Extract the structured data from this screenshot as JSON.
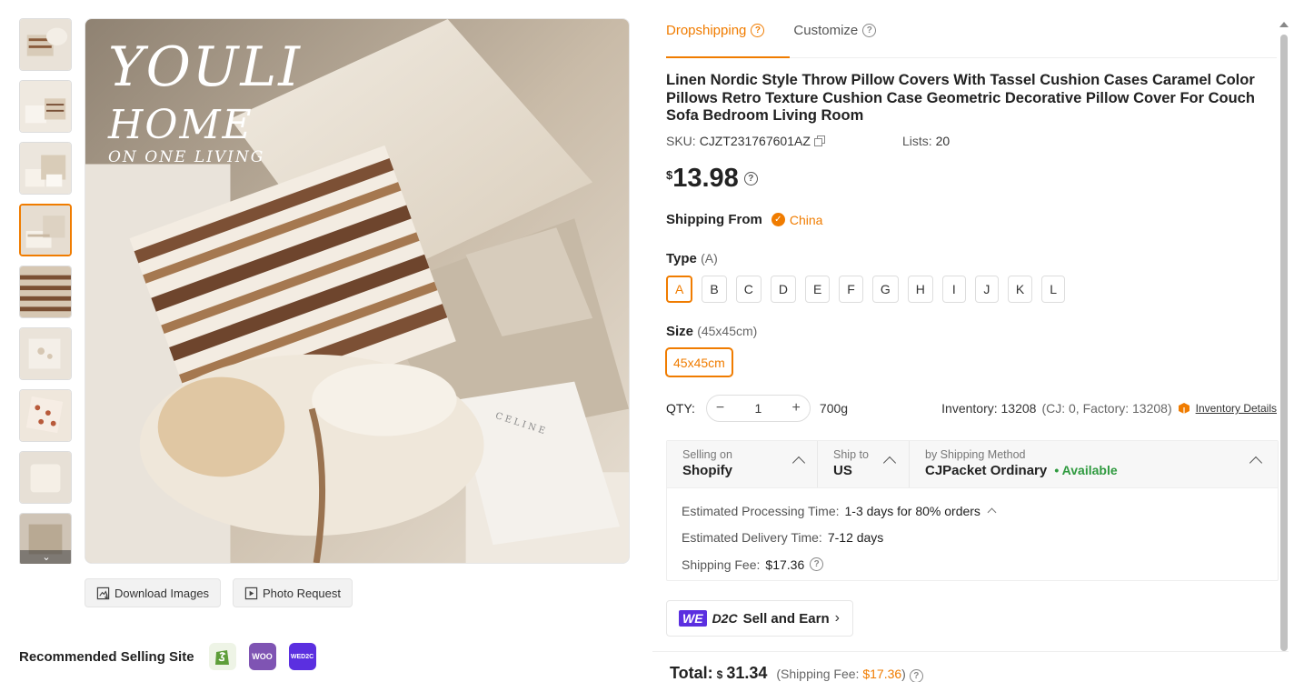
{
  "gallery": {
    "thumb_count": 9,
    "active_index": 3,
    "more_icon": "chevron-down-icon",
    "main_image_alt": "Linen pillow covers arranged on a sofa",
    "brand_line1": "YOULI",
    "brand_line2": "HOME",
    "brand_line3": "ON ONE LIVING",
    "magazine_text": "CELINE"
  },
  "image_actions": {
    "download_label": "Download Images",
    "photo_request_label": "Photo Request"
  },
  "recommended": {
    "label": "Recommended Selling Site",
    "sites": [
      "shopify",
      "woo",
      "wed2c"
    ],
    "woo_text": "WOO",
    "wed2c_text": "WED2C"
  },
  "tabs": [
    {
      "label": "Dropshipping",
      "active": true
    },
    {
      "label": "Customize",
      "active": false
    }
  ],
  "product": {
    "title": "Linen Nordic Style Throw Pillow Covers With Tassel Cushion Cases Caramel Color Pillows Retro Texture Cushion Case Geometric Decorative Pillow Cover For Couch Sofa Bedroom Living Room",
    "sku_label": "SKU:",
    "sku": "CJZT231767601AZ",
    "lists_label": "Lists:",
    "lists": "20",
    "currency": "$",
    "price": "13.98"
  },
  "shipping_from": {
    "label": "Shipping From",
    "value": "China"
  },
  "type": {
    "label": "Type",
    "selected": "(A)",
    "options": [
      "A",
      "B",
      "C",
      "D",
      "E",
      "F",
      "G",
      "H",
      "I",
      "J",
      "K",
      "L"
    ]
  },
  "size": {
    "label": "Size",
    "selected": "(45x45cm)",
    "option": "45x45cm"
  },
  "qty": {
    "label": "QTY:",
    "minus": "−",
    "value": "1",
    "plus": "+",
    "weight": "700g",
    "inventory": "Inventory: 13208",
    "inventory_detail": "(CJ: 0, Factory: 13208)",
    "inventory_link": "Inventory Details"
  },
  "shipping": {
    "selling_on_label": "Selling on",
    "selling_on": "Shopify",
    "ship_to_label": "Ship to",
    "ship_to": "US",
    "method_label": "by Shipping Method",
    "method": "CJPacket Ordinary",
    "availability": "• Available",
    "processing_label": "Estimated Processing Time:",
    "processing": "1-3 days for 80% orders",
    "delivery_label": "Estimated Delivery Time:",
    "delivery": "7-12 days",
    "fee_label": "Shipping Fee:",
    "fee": "$17.36"
  },
  "sell_button": {
    "we": "WE",
    "d2c": "D2C",
    "label": "Sell and Earn",
    "arrow": "›"
  },
  "total": {
    "label": "Total:",
    "currency": "$",
    "value": "31.34",
    "fee_prefix": "(Shipping Fee:",
    "fee": "$17.36",
    "fee_suffix": ")"
  },
  "colors": {
    "accent": "#f07c00",
    "available": "#2f9a3f",
    "wed2c_purple": "#5b2fe0"
  }
}
